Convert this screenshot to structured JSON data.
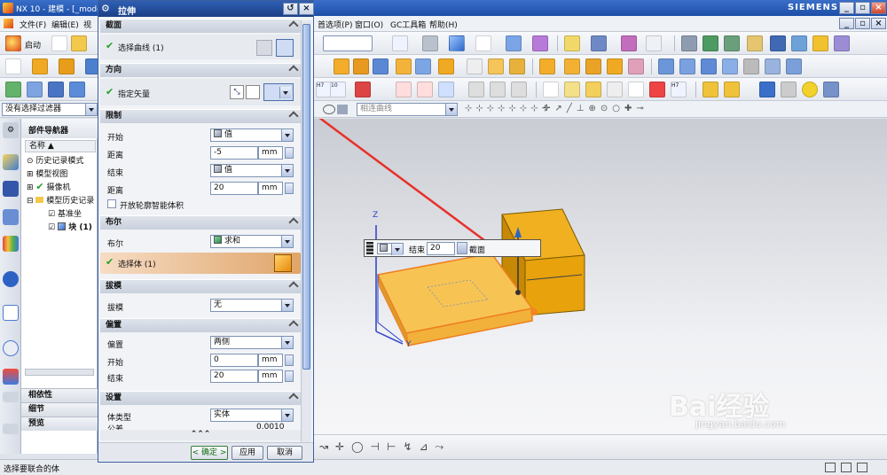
{
  "window": {
    "title": "NX 10 - 建模 - [_mode",
    "brand": "SIEMENS"
  },
  "menu": {
    "file": "文件(F)",
    "edit": "编辑(E)",
    "view": "视",
    "prefs": "首选项(P)",
    "window": "窗口(O)",
    "gc": "GC工具箱",
    "help": "帮助(H)"
  },
  "toolbar": {
    "start": "启动"
  },
  "filter": {
    "selection_filter": "没有选择过滤器",
    "curve_rule": "相连曲线"
  },
  "navigator": {
    "title": "部件导航器",
    "column_name": "名称",
    "items": [
      "历史记录模式",
      "模型视图",
      "摄像机",
      "模型历史记录",
      "基准坐",
      "块 (1)"
    ],
    "footer": [
      "相依性",
      "细节",
      "预览"
    ]
  },
  "dialog": {
    "title": "拉伸",
    "section": {
      "label": "截面",
      "select_curve": "选择曲线 (1)"
    },
    "direction": {
      "label": "方向",
      "vector": "指定矢量"
    },
    "limits": {
      "label": "限制",
      "start_label": "开始",
      "start_value": "值",
      "distance_label": "距离",
      "start_distance": "-5",
      "unit": "mm",
      "end_label": "结束",
      "end_value": "值",
      "end_distance_label": "距离",
      "end_distance": "20",
      "smart_volume": "开放轮廓智能体积"
    },
    "boolean": {
      "label": "布尔",
      "field_label": "布尔",
      "value": "求和",
      "select_body": "选择体 (1)"
    },
    "draft": {
      "label": "拔模",
      "field_label": "拔模",
      "value": "无"
    },
    "offset": {
      "label": "偏置",
      "field_label": "偏置",
      "value": "两侧",
      "start_label": "开始",
      "start_value": "0",
      "end_label": "结束",
      "end_value": "20"
    },
    "settings": {
      "label": "设置",
      "body_type_label": "体类型",
      "body_type": "实体",
      "tolerance_label": "公差",
      "tolerance": "0.0010"
    },
    "buttons": {
      "ok": "< 确定 >",
      "apply": "应用",
      "cancel": "取消"
    }
  },
  "canvas": {
    "handle_label": "结束",
    "handle_value": "20",
    "handle_tag": "截面",
    "axis_z": "Z",
    "axis_y": "Y",
    "watermark_main": "Bai经验",
    "watermark_sub": "jingyan.baidu.com"
  },
  "status": {
    "prompt": "选择要联合的体"
  },
  "colors": {
    "titlebar": "#1c4ea8",
    "solid_body": "#e8a60c",
    "preview": "#f7c454",
    "selection_arrow": "#e8302a"
  }
}
